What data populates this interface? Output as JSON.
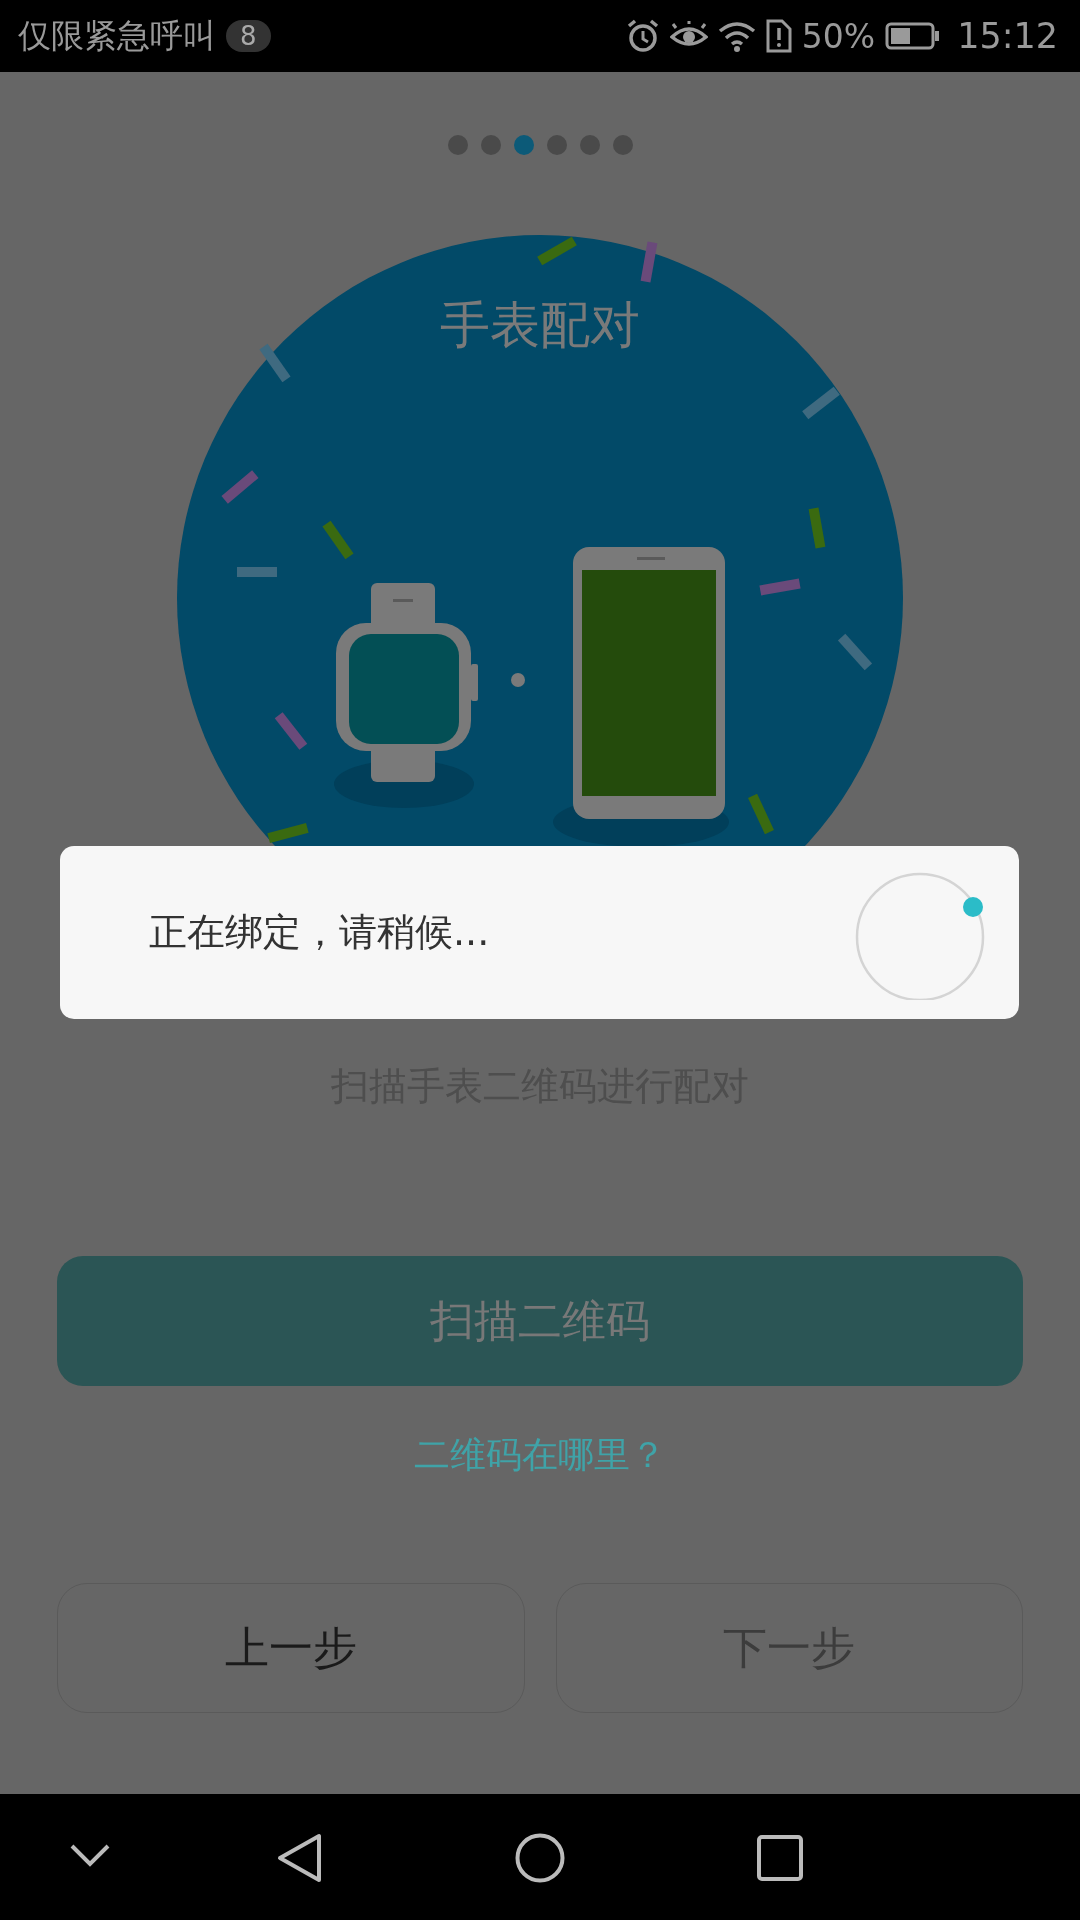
{
  "status_bar": {
    "carrier": "仅限紧急呼叫",
    "notification_count": "8",
    "battery_percent": "50%",
    "time": "15:12"
  },
  "pager": [
    {
      "selected": false
    },
    {
      "selected": false
    },
    {
      "selected": true
    },
    {
      "selected": false
    },
    {
      "selected": false
    },
    {
      "selected": false
    }
  ],
  "hero": {
    "title": "手表配对"
  },
  "instruction": "扫描手表二维码进行配对",
  "scan_button": {
    "label": "扫描二维码"
  },
  "help_link": "二维码在哪里？",
  "nav_buttons": [
    {
      "label": "上一步",
      "disabled": false
    },
    {
      "label": "下一步",
      "disabled": true
    }
  ],
  "dialog": {
    "message": "正在绑定，请稍候..."
  }
}
